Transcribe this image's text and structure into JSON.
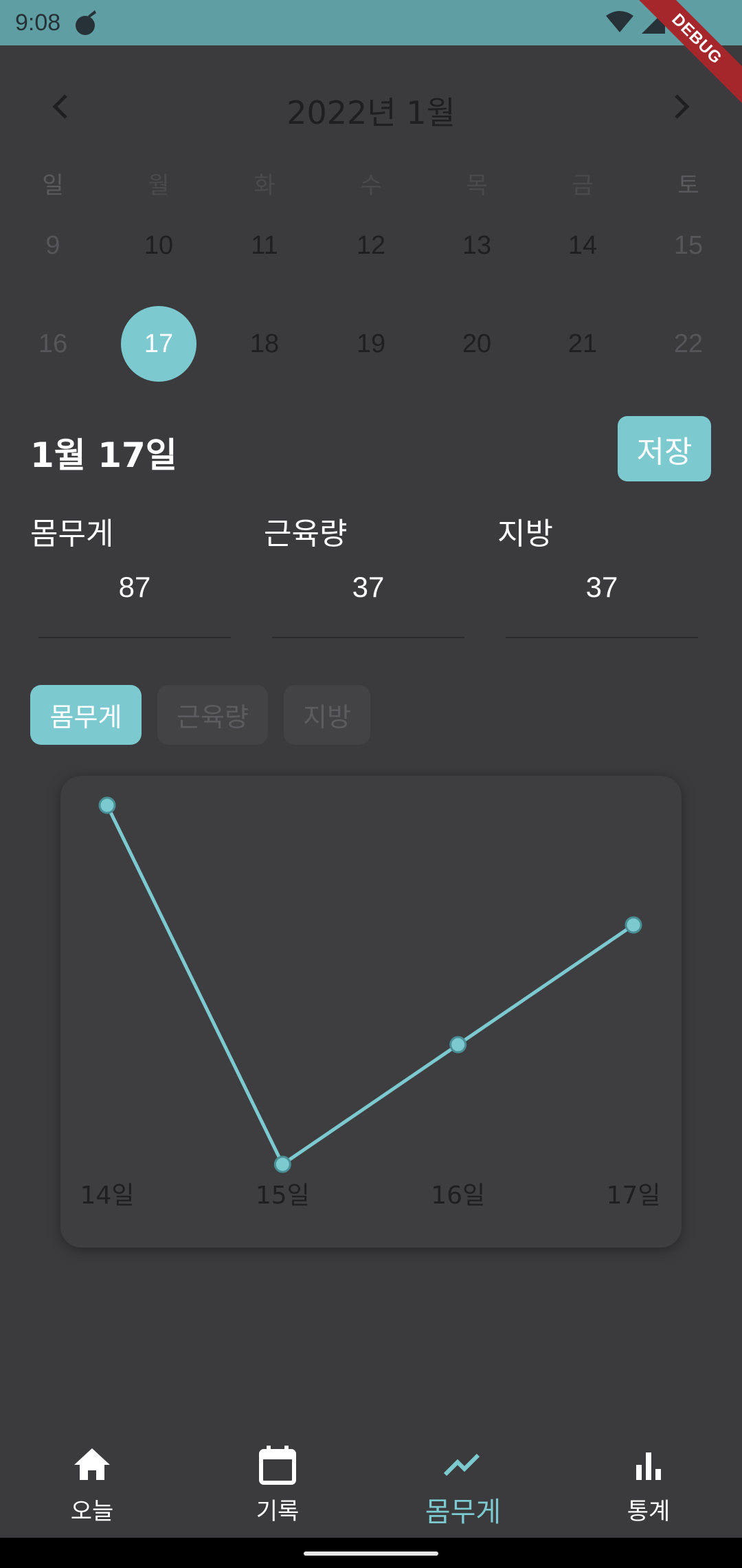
{
  "status_bar": {
    "time": "9:08",
    "debug_label": "DEBUG"
  },
  "calendar": {
    "title": "2022년 1월",
    "weekdays": [
      "일",
      "월",
      "화",
      "수",
      "목",
      "금",
      "토"
    ],
    "weeks": [
      [
        "9",
        "10",
        "11",
        "12",
        "13",
        "14",
        "15"
      ],
      [
        "16",
        "17",
        "18",
        "19",
        "20",
        "21",
        "22"
      ]
    ],
    "selected_day": "17"
  },
  "day": {
    "title": "1월 17일",
    "save_label": "저장"
  },
  "fields": [
    {
      "label": "몸무게",
      "value": "87"
    },
    {
      "label": "근육량",
      "value": "37"
    },
    {
      "label": "지방",
      "value": "37"
    }
  ],
  "tabs": [
    {
      "label": "몸무게",
      "active": true
    },
    {
      "label": "근육량",
      "active": false
    },
    {
      "label": "지방",
      "active": false
    }
  ],
  "chart_data": {
    "type": "line",
    "categories": [
      "14일",
      "15일",
      "16일",
      "17일"
    ],
    "series": [
      {
        "values": [
          90,
          87,
          88,
          89
        ]
      }
    ],
    "ylim": [
      87,
      90
    ],
    "line_color": "#7cc9d0",
    "grid": false
  },
  "bottom_nav": [
    {
      "label": "오늘",
      "icon": "home-icon",
      "active": false
    },
    {
      "label": "기록",
      "icon": "calendar-icon",
      "active": false
    },
    {
      "label": "몸무게",
      "icon": "trending-icon",
      "active": true
    },
    {
      "label": "통계",
      "icon": "bar-chart-icon",
      "active": false
    }
  ],
  "colors": {
    "accent": "#7cc9d0",
    "background": "#3b3b3d",
    "status_bar": "#5f9ea3"
  }
}
